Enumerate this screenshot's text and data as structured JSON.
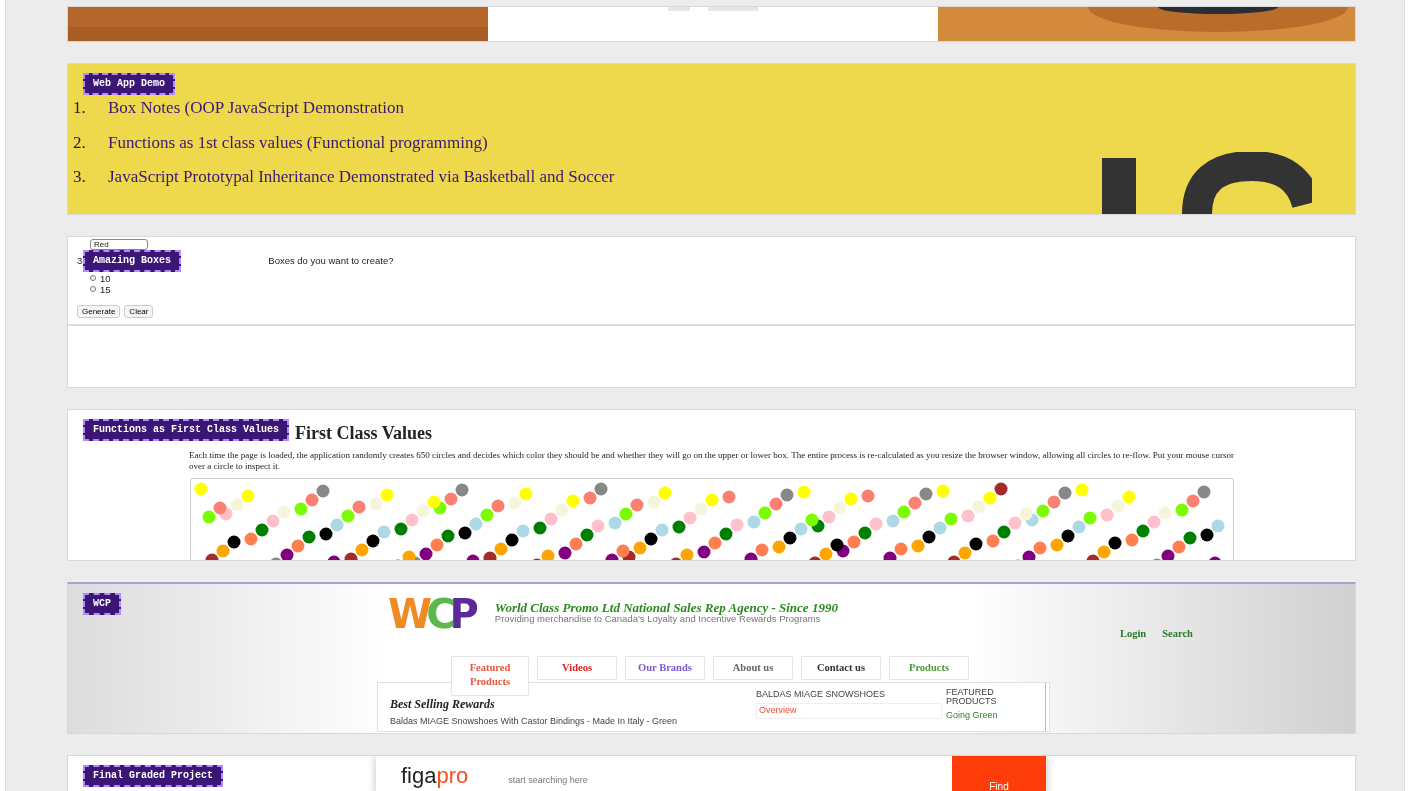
{
  "projects": [
    {
      "kind": "banner"
    },
    {
      "kind": "list",
      "badge": "Web App Demo",
      "items": [
        {
          "number": "1.",
          "text": "Box Notes (OOP JavaScript Demonstration"
        },
        {
          "number": "2.",
          "text": "Functions as 1st class values (Functional programming)"
        },
        {
          "number": "3.",
          "text": "JavaScript Prototypal Inheritance Demonstrated via Basketball and Soccer"
        }
      ]
    },
    {
      "kind": "form",
      "badge": "Amazing Boxes",
      "select": "Red",
      "number": "3",
      "question": "Boxes do you want to create?",
      "options": [
        {
          "label": "10",
          "selected": false
        },
        {
          "label": "15",
          "selected": false
        }
      ],
      "buttons": [
        "Generate",
        "Clear"
      ]
    },
    {
      "kind": "circles",
      "badge": "Functions as First Class Values",
      "title": "First Class Values",
      "text": "Each time the page is loaded, the application randomly creates 650 circles and decides which color they should be and whether they will go on the upper or lower box. The entire process is re-calculated as you resize the browser window, allowing all circles to re-flow. Put your mouse cursor over a circle to inspect it."
    },
    {
      "kind": "site",
      "badge": "WCP",
      "logo": [
        {
          "letter": "W",
          "color": "#f08a24"
        },
        {
          "letter": "C",
          "color": "#5cb84a"
        },
        {
          "letter": "P",
          "color": "#5a2a9a"
        }
      ],
      "tagline": "World Class Promo Ltd National Sales Rep Agency - Since 1990",
      "subtitle": "Providing merchandise to Canada's Loyalty and Incentive Rewards Programs",
      "top_links": [
        "Login",
        "Search"
      ],
      "nav": [
        {
          "label": "Featured Products",
          "color": "#e8553a"
        },
        {
          "label": "Videos",
          "color": "#e02020"
        },
        {
          "label": "Our Brands",
          "color": "#7a5ad0"
        },
        {
          "label": "About us",
          "color": "#666666"
        },
        {
          "label": "Contact us",
          "color": "#333333"
        },
        {
          "label": "Products",
          "color": "#4a9a3a"
        }
      ],
      "heading": "Best Selling Rewards",
      "item": "Baldas MIAGE Snowshoes With Castor Bindings - Made In Italy - Green",
      "product_title": "BALDAS MIAGE SNOWSHOES",
      "tab": "Overview",
      "featured_heading": "FEATURED PRODUCTS",
      "featured_link": "Going Green"
    },
    {
      "kind": "search",
      "badge": "Final Graded Project",
      "logo_start": "figa",
      "logo_end": "pro",
      "placeholder": "start searching here",
      "button": "Find"
    }
  ]
}
